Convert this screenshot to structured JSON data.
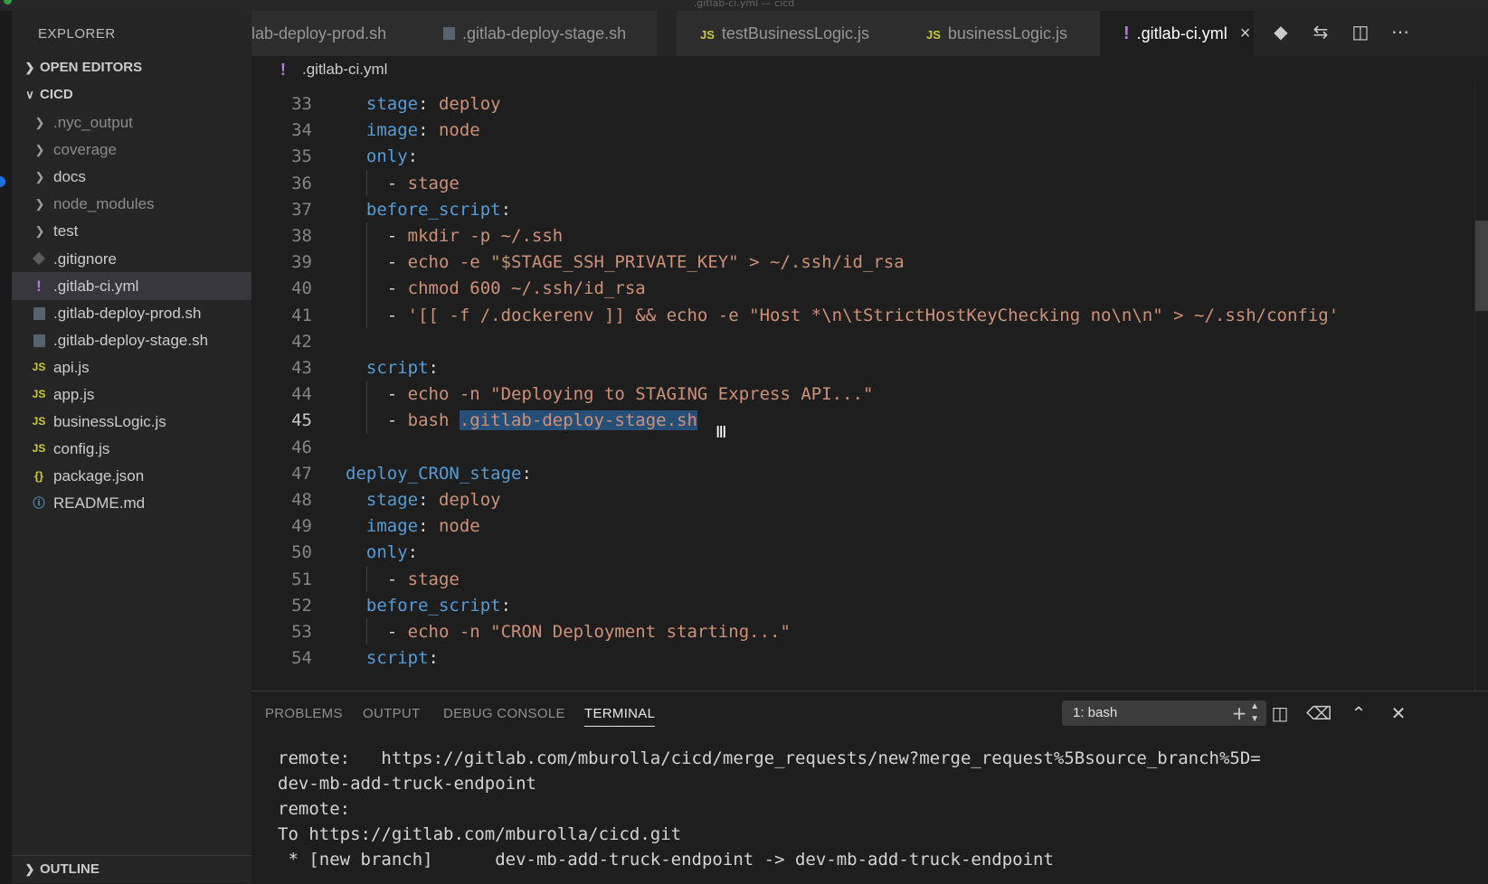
{
  "window": {
    "title": ".gitlab-ci.yml — cicd"
  },
  "sidebar": {
    "title": "EXPLORER",
    "open_editors": "OPEN EDITORS",
    "folder": "CICD",
    "outline": "OUTLINE",
    "items": [
      {
        "label": ".nyc_output",
        "kind": "folder",
        "dim": true
      },
      {
        "label": "coverage",
        "kind": "folder",
        "dim": true
      },
      {
        "label": "docs",
        "kind": "folder"
      },
      {
        "label": "node_modules",
        "kind": "folder",
        "dim": true
      },
      {
        "label": "test",
        "kind": "folder"
      },
      {
        "label": ".gitignore",
        "kind": "git"
      },
      {
        "label": ".gitlab-ci.yml",
        "kind": "yml",
        "selected": true
      },
      {
        "label": ".gitlab-deploy-prod.sh",
        "kind": "sh"
      },
      {
        "label": ".gitlab-deploy-stage.sh",
        "kind": "sh"
      },
      {
        "label": "api.js",
        "kind": "js"
      },
      {
        "label": "app.js",
        "kind": "js"
      },
      {
        "label": "businessLogic.js",
        "kind": "js"
      },
      {
        "label": "config.js",
        "kind": "js"
      },
      {
        "label": "package.json",
        "kind": "json"
      },
      {
        "label": "README.md",
        "kind": "md"
      }
    ]
  },
  "tabs": [
    {
      "label": "lab-deploy-prod.sh",
      "kind": "none"
    },
    {
      "label": ".gitlab-deploy-stage.sh",
      "kind": "sh"
    },
    {
      "label": "testBusinessLogic.js",
      "kind": "js"
    },
    {
      "label": "businessLogic.js",
      "kind": "js"
    },
    {
      "label": ".gitlab-ci.yml",
      "kind": "yml",
      "active": true
    }
  ],
  "icon_labels": {
    "js": "JS",
    "json": "{}",
    "yml": "!",
    "md": "ⓘ",
    "close": "×"
  },
  "breadcrumb": {
    "file": ".gitlab-ci.yml"
  },
  "editor": {
    "current_line": 45,
    "lines": [
      {
        "n": 33,
        "tokens": [
          [
            "p",
            "  "
          ],
          [
            "k",
            "stage"
          ],
          [
            "p",
            ": "
          ],
          [
            "v",
            "deploy"
          ]
        ]
      },
      {
        "n": 34,
        "tokens": [
          [
            "p",
            "  "
          ],
          [
            "k",
            "image"
          ],
          [
            "p",
            ": "
          ],
          [
            "v",
            "node"
          ]
        ]
      },
      {
        "n": 35,
        "tokens": [
          [
            "p",
            "  "
          ],
          [
            "k",
            "only"
          ],
          [
            "p",
            ":"
          ]
        ]
      },
      {
        "n": 36,
        "tokens": [
          [
            "p",
            "    - "
          ],
          [
            "v",
            "stage"
          ]
        ]
      },
      {
        "n": 37,
        "tokens": [
          [
            "p",
            "  "
          ],
          [
            "k",
            "before_script"
          ],
          [
            "p",
            ":"
          ]
        ]
      },
      {
        "n": 38,
        "tokens": [
          [
            "p",
            "    - "
          ],
          [
            "v",
            "mkdir -p ~/.ssh"
          ]
        ]
      },
      {
        "n": 39,
        "tokens": [
          [
            "p",
            "    - "
          ],
          [
            "v",
            "echo -e \"$STAGE_SSH_PRIVATE_KEY\" > ~/.ssh/id_rsa"
          ]
        ]
      },
      {
        "n": 40,
        "tokens": [
          [
            "p",
            "    - "
          ],
          [
            "v",
            "chmod 600 ~/.ssh/id_rsa"
          ]
        ]
      },
      {
        "n": 41,
        "tokens": [
          [
            "p",
            "    - "
          ],
          [
            "v",
            "'[[ -f /.dockerenv ]] && echo -e \"Host *\\n\\tStrictHostKeyChecking no\\n\\n\" > ~/.ssh/config'"
          ]
        ]
      },
      {
        "n": 42,
        "tokens": []
      },
      {
        "n": 43,
        "tokens": [
          [
            "p",
            "  "
          ],
          [
            "k",
            "script"
          ],
          [
            "p",
            ":"
          ]
        ]
      },
      {
        "n": 44,
        "tokens": [
          [
            "p",
            "    - "
          ],
          [
            "v",
            "echo -n \"Deploying to STAGING Express API...\""
          ]
        ]
      },
      {
        "n": 45,
        "tokens": [
          [
            "p",
            "    - "
          ],
          [
            "v",
            "bash "
          ],
          [
            "sel",
            ".gitlab-deploy-stage.sh"
          ]
        ]
      },
      {
        "n": 46,
        "tokens": []
      },
      {
        "n": 47,
        "tokens": [
          [
            "k",
            "deploy_CRON_stage"
          ],
          [
            "p",
            ":"
          ]
        ]
      },
      {
        "n": 48,
        "tokens": [
          [
            "p",
            "  "
          ],
          [
            "k",
            "stage"
          ],
          [
            "p",
            ": "
          ],
          [
            "v",
            "deploy"
          ]
        ]
      },
      {
        "n": 49,
        "tokens": [
          [
            "p",
            "  "
          ],
          [
            "k",
            "image"
          ],
          [
            "p",
            ": "
          ],
          [
            "v",
            "node"
          ]
        ]
      },
      {
        "n": 50,
        "tokens": [
          [
            "p",
            "  "
          ],
          [
            "k",
            "only"
          ],
          [
            "p",
            ":"
          ]
        ]
      },
      {
        "n": 51,
        "tokens": [
          [
            "p",
            "    - "
          ],
          [
            "v",
            "stage"
          ]
        ]
      },
      {
        "n": 52,
        "tokens": [
          [
            "p",
            "  "
          ],
          [
            "k",
            "before_script"
          ],
          [
            "p",
            ":"
          ]
        ]
      },
      {
        "n": 53,
        "tokens": [
          [
            "p",
            "    - "
          ],
          [
            "v",
            "echo -n \"CRON Deployment starting...\""
          ]
        ]
      },
      {
        "n": 54,
        "tokens": [
          [
            "p",
            "  "
          ],
          [
            "k",
            "script"
          ],
          [
            "p",
            ":"
          ]
        ]
      }
    ]
  },
  "panel": {
    "tabs": [
      "PROBLEMS",
      "OUTPUT",
      "DEBUG CONSOLE",
      "TERMINAL"
    ],
    "active_tab": "TERMINAL",
    "terminal_select": "1: bash",
    "terminal_lines": [
      "remote:   https://gitlab.com/mburolla/cicd/merge_requests/new?merge_request%5Bsource_branch%5D=",
      "dev-mb-add-truck-endpoint",
      "remote:",
      "To https://gitlab.com/mburolla/cicd.git",
      " * [new branch]      dev-mb-add-truck-endpoint -> dev-mb-add-truck-endpoint"
    ]
  },
  "colors": {
    "keyword": "#569cd6",
    "string": "#ce9178",
    "selection": "#264f78",
    "yml_icon": "#b07cd8",
    "js_icon": "#cbcb41"
  }
}
